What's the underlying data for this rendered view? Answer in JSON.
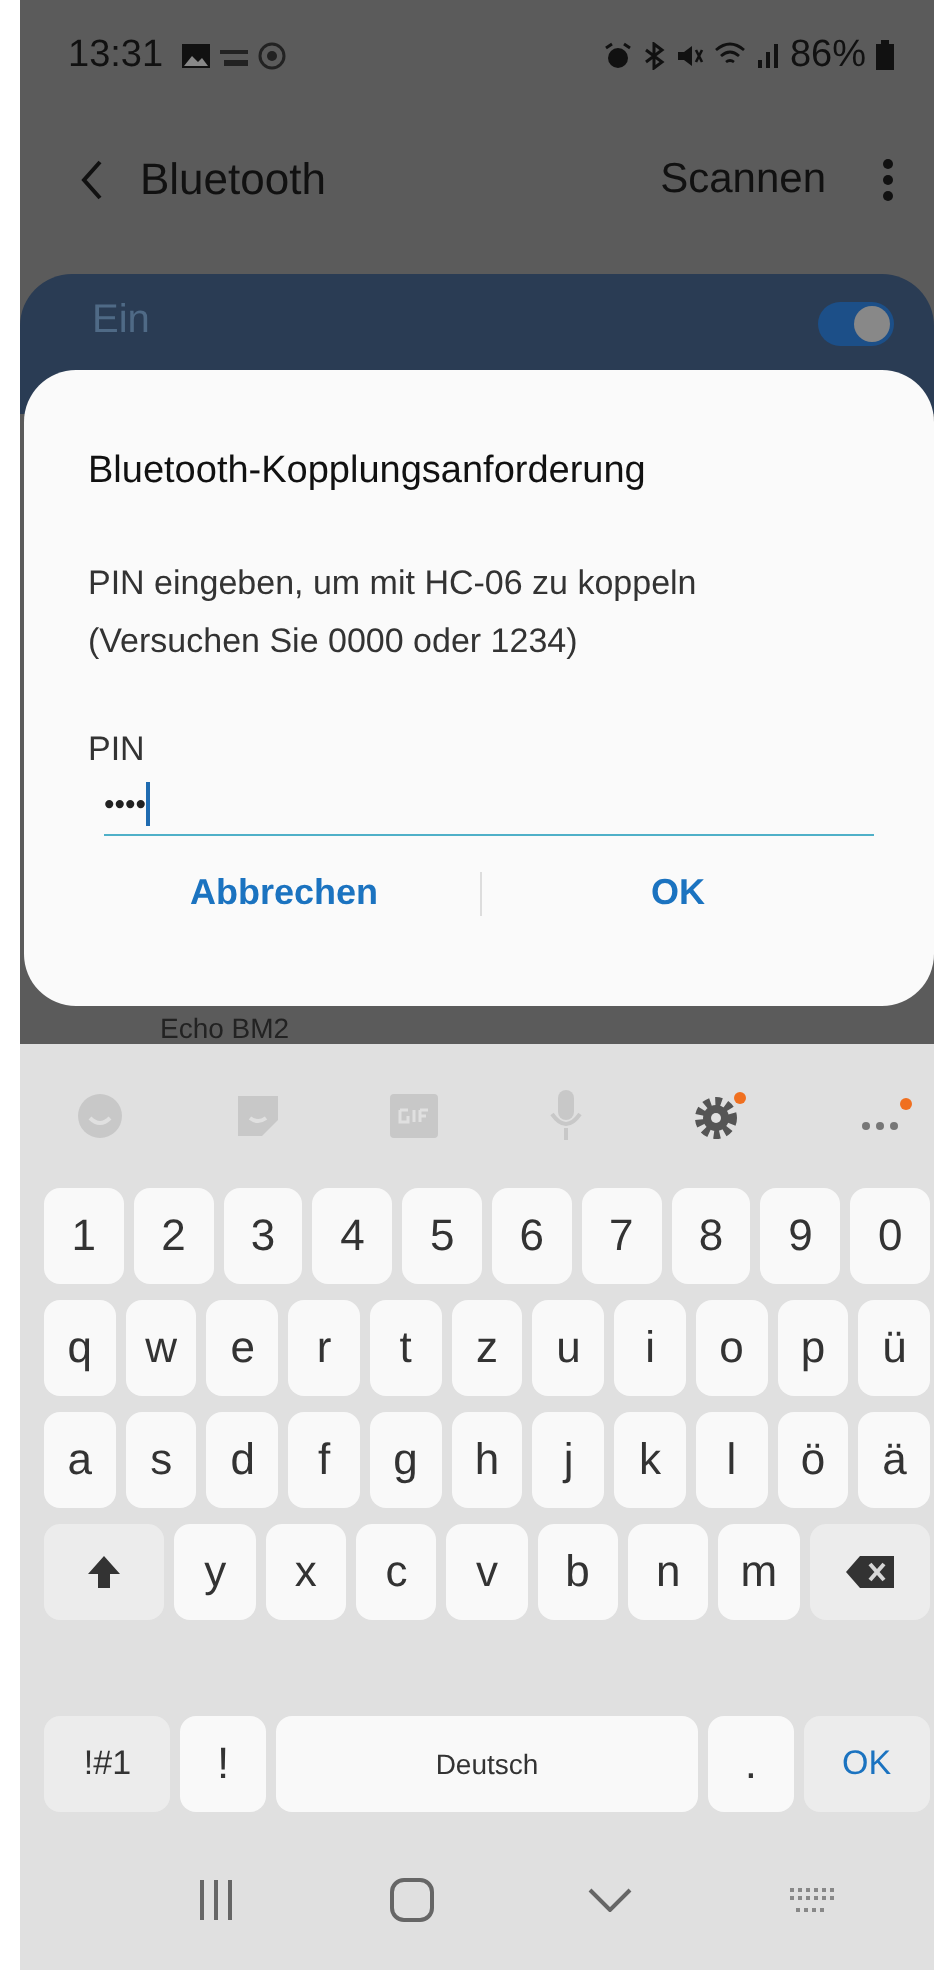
{
  "status_bar": {
    "time": "13:31",
    "battery": "86%"
  },
  "header": {
    "title": "Bluetooth",
    "action": "Scannen"
  },
  "bluetooth_card": {
    "label": "Ein",
    "on": true
  },
  "dialog": {
    "title": "Bluetooth-Kopplungsanforderung",
    "message_lines": [
      "PIN eingeben, um mit HC-06 zu koppeln",
      "(Versuchen Sie 0000 oder 1234)"
    ],
    "field": {
      "label": "PIN",
      "value": "••••"
    },
    "buttons": [
      "Abbrechen",
      "OK"
    ]
  },
  "background_device": "Echo BM2",
  "keyboard": {
    "rows": [
      {
        "keys": [
          {
            "label": "1",
            "kind": "char"
          },
          {
            "label": "2",
            "kind": "char"
          },
          {
            "label": "3",
            "kind": "char"
          },
          {
            "label": "4",
            "kind": "char"
          },
          {
            "label": "5",
            "kind": "char"
          },
          {
            "label": "6",
            "kind": "char"
          },
          {
            "label": "7",
            "kind": "char"
          },
          {
            "label": "8",
            "kind": "char"
          },
          {
            "label": "9",
            "kind": "char"
          },
          {
            "label": "0",
            "kind": "char"
          }
        ]
      },
      {
        "keys": [
          {
            "label": "q",
            "kind": "char"
          },
          {
            "label": "w",
            "kind": "char"
          },
          {
            "label": "e",
            "kind": "char"
          },
          {
            "label": "r",
            "kind": "char"
          },
          {
            "label": "t",
            "kind": "char"
          },
          {
            "label": "z",
            "kind": "char"
          },
          {
            "label": "u",
            "kind": "char"
          },
          {
            "label": "i",
            "kind": "char"
          },
          {
            "label": "o",
            "kind": "char"
          },
          {
            "label": "p",
            "kind": "char"
          },
          {
            "label": "ü",
            "kind": "char"
          }
        ]
      },
      {
        "keys": [
          {
            "label": "a",
            "kind": "char"
          },
          {
            "label": "s",
            "kind": "char"
          },
          {
            "label": "d",
            "kind": "char"
          },
          {
            "label": "f",
            "kind": "char"
          },
          {
            "label": "g",
            "kind": "char"
          },
          {
            "label": "h",
            "kind": "char"
          },
          {
            "label": "j",
            "kind": "char"
          },
          {
            "label": "k",
            "kind": "char"
          },
          {
            "label": "l",
            "kind": "char"
          },
          {
            "label": "ö",
            "kind": "char"
          },
          {
            "label": "ä",
            "kind": "char"
          }
        ]
      },
      {
        "keys": [
          {
            "kind": "shift"
          },
          {
            "label": "y",
            "kind": "char"
          },
          {
            "label": "x",
            "kind": "char"
          },
          {
            "label": "c",
            "kind": "char"
          },
          {
            "label": "v",
            "kind": "char"
          },
          {
            "label": "b",
            "kind": "char"
          },
          {
            "label": "n",
            "kind": "char"
          },
          {
            "label": "m",
            "kind": "char"
          },
          {
            "kind": "backspace"
          }
        ]
      },
      {
        "keys": [
          {
            "label": "!#1",
            "kind": "symbols"
          },
          {
            "label": "!",
            "kind": "char"
          },
          {
            "label": "Deutsch",
            "kind": "space"
          },
          {
            "label": ".",
            "kind": "char"
          },
          {
            "label": "OK",
            "kind": "action"
          }
        ]
      }
    ]
  }
}
